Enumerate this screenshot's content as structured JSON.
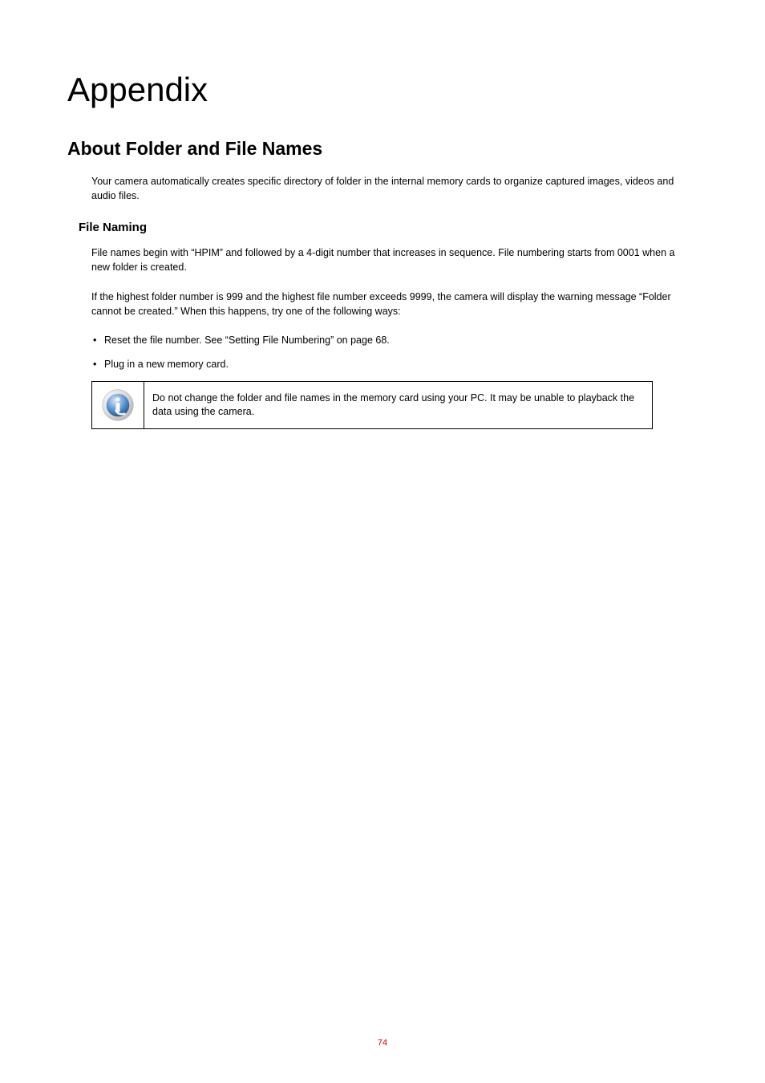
{
  "chapter_title": "Appendix",
  "section_title": "About Folder and File Names",
  "intro_text": "Your camera automatically creates specific directory of folder in the internal memory cards to organize captured images, videos and audio files.",
  "sub_title": "File Naming",
  "paragraph_1": "File names begin with “HPIM” and followed by a 4-digit number that increases in sequence.  File numbering starts from 0001 when a new folder is created.",
  "paragraph_2": "If the highest folder number is 999 and the highest file number exceeds 9999, the camera will display the warning message “Folder cannot be created.”  When this happens, try one of the following ways:",
  "bullets": [
    "Reset the file number.  See “Setting File Numbering” on page 68.",
    "Plug in a new memory card."
  ],
  "note_text": "Do not change the folder and file names in the memory card using your PC.  It may be unable to playback the data using the camera.",
  "page_number": "74"
}
